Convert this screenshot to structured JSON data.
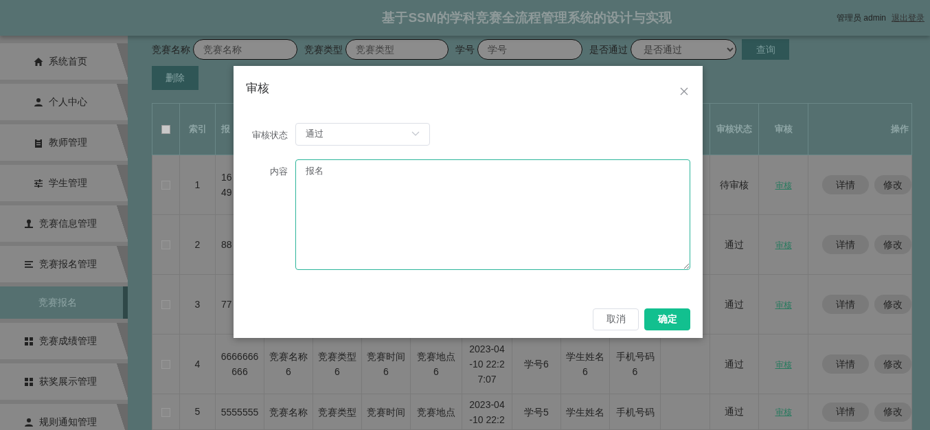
{
  "header": {
    "title": "基于SSM的学科竞赛全流程管理系统的设计与实现",
    "user": "管理员 admin",
    "logout": "退出登录"
  },
  "sidebar": {
    "items": [
      {
        "label": "系统首页",
        "selected": false
      },
      {
        "label": "个人中心",
        "selected": false
      },
      {
        "label": "教师管理",
        "selected": false
      },
      {
        "label": "学生管理",
        "selected": false
      },
      {
        "label": "竞赛信息管理",
        "selected": false
      },
      {
        "label": "竞赛报名管理",
        "selected": false,
        "expanded": true,
        "children": [
          {
            "label": "竞赛报名",
            "selected": true
          }
        ]
      },
      {
        "label": "竞赛成绩管理",
        "selected": false
      },
      {
        "label": "获奖展示管理",
        "selected": false
      },
      {
        "label": "规则通知管理",
        "selected": false
      }
    ]
  },
  "search": {
    "fields": [
      {
        "kind": "text",
        "label": "竞赛名称",
        "placeholder": "竞赛名称"
      },
      {
        "kind": "text",
        "label": "竞赛类型",
        "placeholder": "竞赛类型"
      },
      {
        "kind": "text",
        "label": "学号",
        "placeholder": "学号"
      },
      {
        "kind": "select",
        "label": "是否通过",
        "placeholder": "是否通过"
      }
    ],
    "button": "查询"
  },
  "toolbar": {
    "delete_button": "删除"
  },
  "table": {
    "select_all": {
      "checked": false
    },
    "columns": [
      {
        "kind": "text",
        "label": "索引"
      },
      {
        "kind": "text",
        "label": "报"
      },
      {
        "kind": "covered"
      },
      {
        "kind": "covered"
      },
      {
        "kind": "covered"
      },
      {
        "kind": "covered"
      },
      {
        "kind": "covered"
      },
      {
        "kind": "covered"
      },
      {
        "kind": "covered"
      },
      {
        "kind": "covered"
      },
      {
        "kind": "covered"
      },
      {
        "kind": "text",
        "label": "审核状态"
      },
      {
        "kind": "text",
        "label": "审核"
      },
      {
        "kind": "text",
        "label": "操作"
      }
    ],
    "rows": [
      {
        "checked": false,
        "cells": [
          "1",
          "16\n49",
          null,
          null,
          null,
          null,
          null,
          null,
          null,
          null,
          null,
          "待审核",
          "审核"
        ],
        "actions": [
          "详情",
          "修改"
        ]
      },
      {
        "checked": false,
        "cells": [
          "2",
          "88",
          null,
          null,
          null,
          null,
          null,
          null,
          null,
          null,
          null,
          "通过",
          "审核"
        ],
        "actions": [
          "详情",
          "修改"
        ]
      },
      {
        "checked": false,
        "cells": [
          "3",
          "77",
          null,
          null,
          null,
          null,
          null,
          null,
          null,
          null,
          null,
          "通过",
          "审核"
        ],
        "actions": [
          "详情",
          "修改"
        ]
      },
      {
        "checked": false,
        "cells": [
          "4",
          "6666666666",
          "竞赛名称6",
          "竞赛类型6",
          "竞赛时间6",
          "竞赛地点6",
          "2023-04-10 22:27:07",
          "学号6",
          "学生姓名6",
          "手机号码6",
          null,
          "通过",
          "审核"
        ],
        "actions": [
          "详情",
          "修改"
        ]
      },
      {
        "checked": false,
        "cells": [
          "5",
          "5555555",
          "竞赛名称",
          "竞赛类型",
          "竞赛时间",
          "竞赛地点",
          "2023-04-10 22:2",
          "学号5",
          "学生姓名",
          "手机号码",
          null,
          "通过",
          "审核"
        ],
        "actions": [
          "详情",
          "修改"
        ]
      }
    ]
  },
  "dialog": {
    "title": "审核",
    "fields": [
      {
        "kind": "select",
        "label": "审核状态",
        "value": "通过"
      },
      {
        "kind": "textarea",
        "label": "内容",
        "value": "报名",
        "focused": true
      }
    ],
    "buttons": [
      {
        "kind": "secondary",
        "label": "取消"
      },
      {
        "kind": "primary",
        "label": "确定"
      }
    ]
  }
}
